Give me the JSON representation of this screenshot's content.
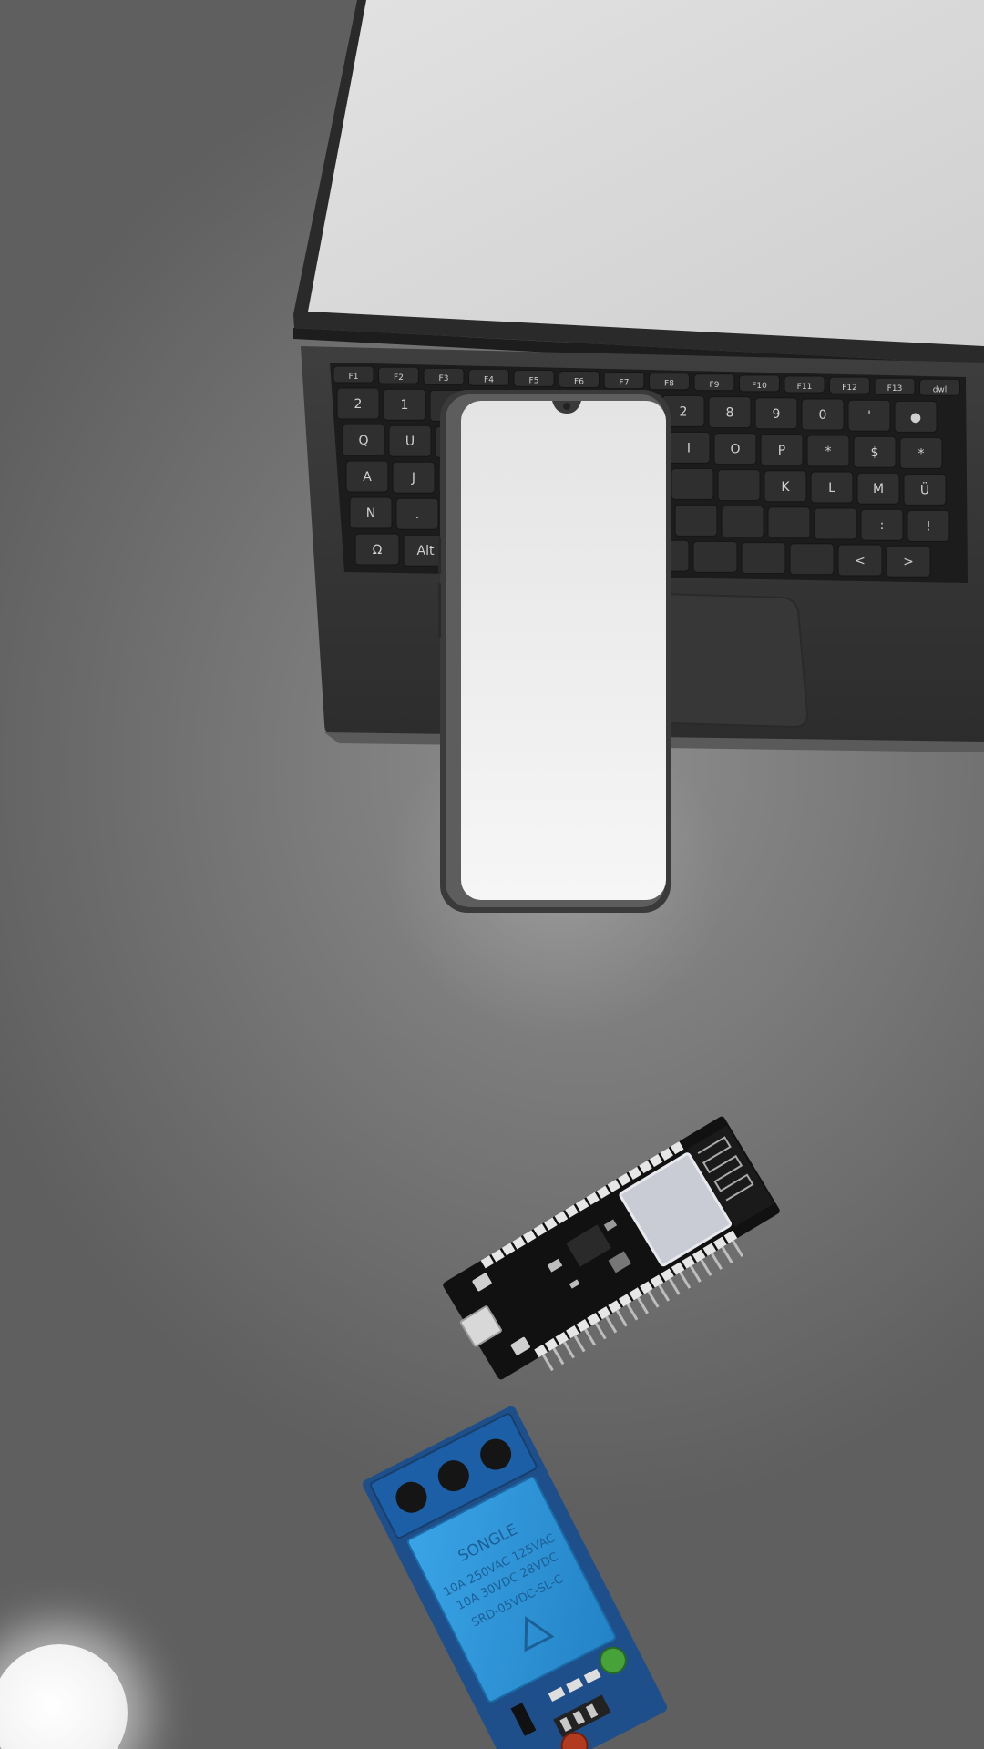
{
  "scene": {
    "background_color": "#7a7a7a",
    "objects": [
      {
        "id": "laptop",
        "label": "laptop",
        "screen_color": "#d7d7d7",
        "body_color": "#2e2e2e"
      },
      {
        "id": "smartphone",
        "label": "smartphone",
        "screen_color": "#ececec",
        "frame_color": "#3a3a3a"
      },
      {
        "id": "esp32-board",
        "label": "ESP32 development board",
        "pcb_color": "#121212",
        "shield_color": "#c9ccd4"
      },
      {
        "id": "relay-module",
        "label": "relay module",
        "pcb_color": "#1f4f8a",
        "relay_color": "#2f8fd0"
      },
      {
        "id": "light-bulb",
        "label": "light bulb",
        "color": "#ffffff"
      }
    ]
  },
  "keyboard": {
    "function_row": [
      "F1",
      "F2",
      "F3",
      "F4",
      "F5",
      "F6",
      "F7",
      "F8",
      "F9",
      "F10",
      "F11",
      "F12",
      "F13",
      "dwl"
    ],
    "number_row": [
      "2",
      "1",
      "2",
      "8",
      "9",
      "0",
      "'",
      "●"
    ],
    "row_q": [
      "Q",
      "U",
      "I",
      "O",
      "P",
      "*",
      "$",
      "*"
    ],
    "row_a": [
      "A",
      "J",
      "K",
      "L",
      "M",
      "Ü"
    ],
    "row_z": [
      "N",
      ".",
      ":",
      "!"
    ],
    "bottom_row": [
      "Ω",
      "Alt",
      "<",
      ">"
    ]
  },
  "relay": {
    "model": "SRD-05VDC-SL-C",
    "rating_1": "10A 250VAC 125VAC",
    "rating_2": "10A 30VDC 28VDC",
    "brand": "SONGLE"
  }
}
